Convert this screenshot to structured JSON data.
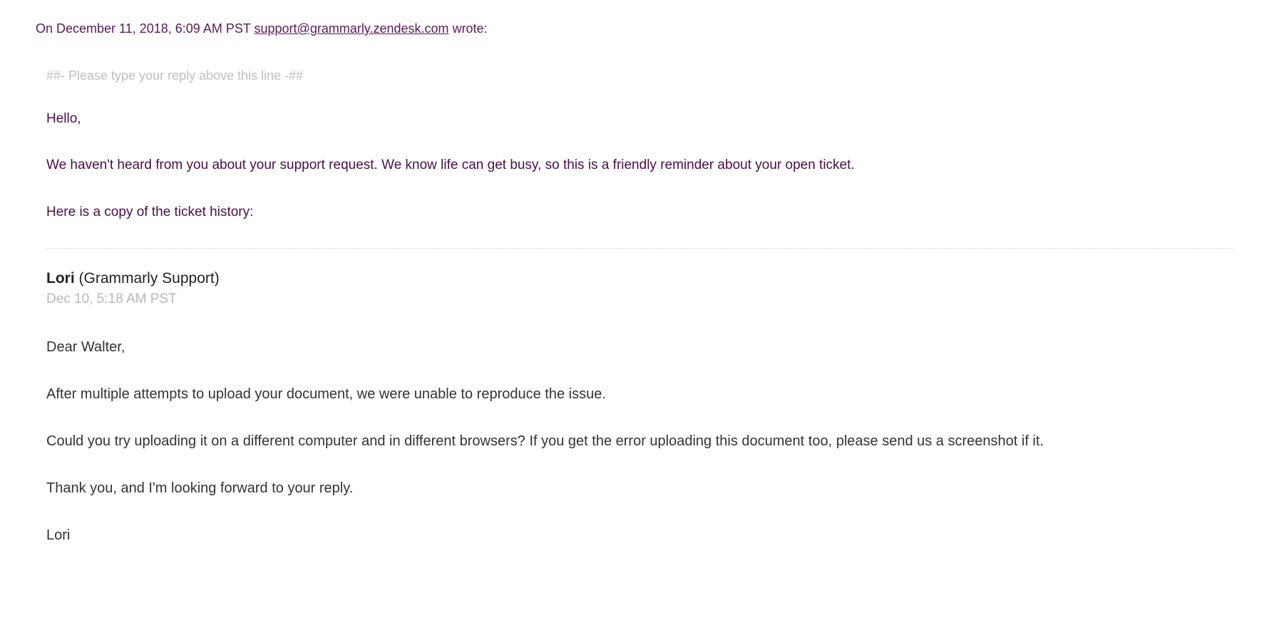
{
  "header": {
    "prefix": "On December 11, 2018, 6:09 AM PST ",
    "email": "support@grammarly.zendesk.com",
    "suffix": " wrote:"
  },
  "replyMarker": "##- Please type your reply above this line -##",
  "intro": {
    "greeting": "Hello,",
    "reminder": "We haven't heard from you about your support request. We know life can get busy, so this is a friendly reminder about your open ticket.",
    "historyNote": "Here is a copy of the ticket history:"
  },
  "author": {
    "name": "Lori",
    "context": " (Grammarly Support)",
    "timestamp": "Dec 10, 5:18 AM PST"
  },
  "body": {
    "salutation": "Dear Walter,",
    "p1": "After multiple attempts to upload your document, we were unable to reproduce the issue.",
    "p2": "Could you try uploading it on a different computer and in different browsers? If you get the error uploading this document too, please send us a screenshot if it.",
    "p3": "Thank you, and I'm looking forward to your reply.",
    "signoff": "Lori"
  }
}
